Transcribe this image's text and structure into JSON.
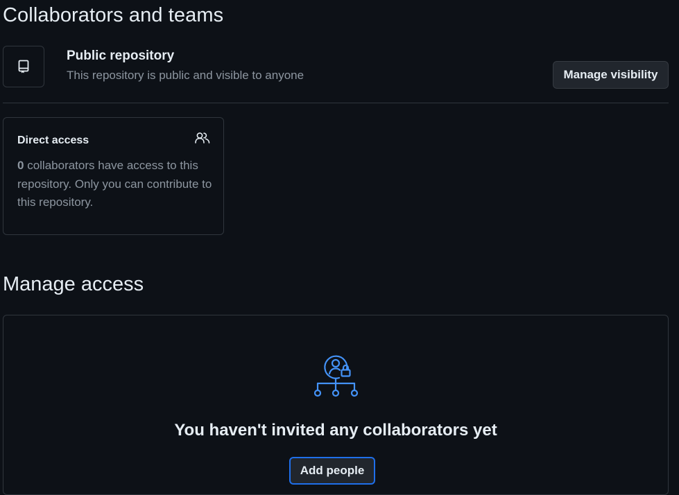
{
  "page": {
    "title": "Collaborators and teams"
  },
  "repository": {
    "title": "Public repository",
    "description": "This repository is public and visible to anyone",
    "manage_visibility_label": "Manage visibility",
    "icon": "repo-icon"
  },
  "direct_access": {
    "title": "Direct access",
    "icon": "people-icon",
    "count": "0",
    "text_rest": " collaborators have access to this repository. Only you can contribute to this repository."
  },
  "manage_access": {
    "title": "Manage access",
    "empty_title": "You haven't invited any collaborators yet",
    "add_people_label": "Add people",
    "icon": "collaborators-lock-icon"
  },
  "colors": {
    "background": "#0d1117",
    "border": "#30363d",
    "accent": "#1f6feb",
    "icon_blue": "#4493f8",
    "muted_text": "#8d96a0"
  }
}
